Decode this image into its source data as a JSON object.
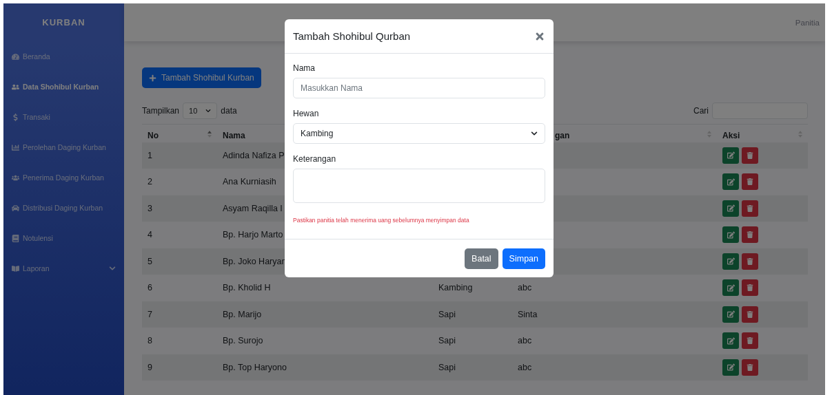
{
  "sidebar": {
    "brand": "KURBAN",
    "items": [
      {
        "label": "Beranda",
        "selected": false,
        "has_submenu": false
      },
      {
        "label": "Data Shohibul Kurban",
        "selected": true,
        "has_submenu": false
      },
      {
        "label": "Transaki",
        "selected": false,
        "has_submenu": false
      },
      {
        "label": "Perolehan Daging Kurban",
        "selected": false,
        "has_submenu": false
      },
      {
        "label": "Penerima Daging Kurban",
        "selected": false,
        "has_submenu": false
      },
      {
        "label": "Distribusi Daging Kurban",
        "selected": false,
        "has_submenu": false
      },
      {
        "label": "Notulensi",
        "selected": false,
        "has_submenu": false
      },
      {
        "label": "Laporan",
        "selected": false,
        "has_submenu": true
      }
    ]
  },
  "topbar": {
    "user": "Panitia"
  },
  "add_button": "Tambah Shohibul Kurban",
  "length_control": {
    "prefix": "Tampilkan",
    "value": "10",
    "suffix": "data"
  },
  "search": {
    "label": "Cari"
  },
  "table": {
    "columns": [
      "No",
      "Nama",
      "",
      "gan",
      "Aksi"
    ],
    "rows": [
      {
        "no": "1",
        "nama": "Adinda Nafiza P"
      },
      {
        "no": "2",
        "nama": "Ana Kurniasih"
      },
      {
        "no": "3",
        "nama": "Asyam Raqilla I"
      },
      {
        "no": "4",
        "nama": "Bp. Harjo Marto"
      },
      {
        "no": "5",
        "nama": "Bp. Joko Haryan"
      },
      {
        "no": "6",
        "nama": "Bp. Kholid H",
        "hewan": "Kambing",
        "keterangan": "abc"
      },
      {
        "no": "7",
        "nama": "Bp. Marijo",
        "hewan": "Sapi",
        "keterangan": "Sinta"
      },
      {
        "no": "8",
        "nama": "Bp. Surojo",
        "hewan": "Sapi",
        "keterangan": "abc"
      },
      {
        "no": "9",
        "nama": "Bp. Top Haryono",
        "hewan": "Sapi",
        "keterangan": "abc"
      }
    ]
  },
  "modal": {
    "title": "Tambah Shohibul Qurban",
    "fields": [
      {
        "kind": "input",
        "label": "Nama",
        "placeholder": "Masukkan Nama"
      },
      {
        "kind": "select",
        "label": "Hewan",
        "value": "Kambing"
      },
      {
        "kind": "textarea",
        "label": "Keterangan"
      }
    ],
    "note": "Pastikan panitia telah menerima uang sebelumnya menyimpan data",
    "buttons": [
      {
        "label": "Batal",
        "kind": "secondary"
      },
      {
        "label": "Simpan",
        "kind": "primary"
      }
    ]
  }
}
